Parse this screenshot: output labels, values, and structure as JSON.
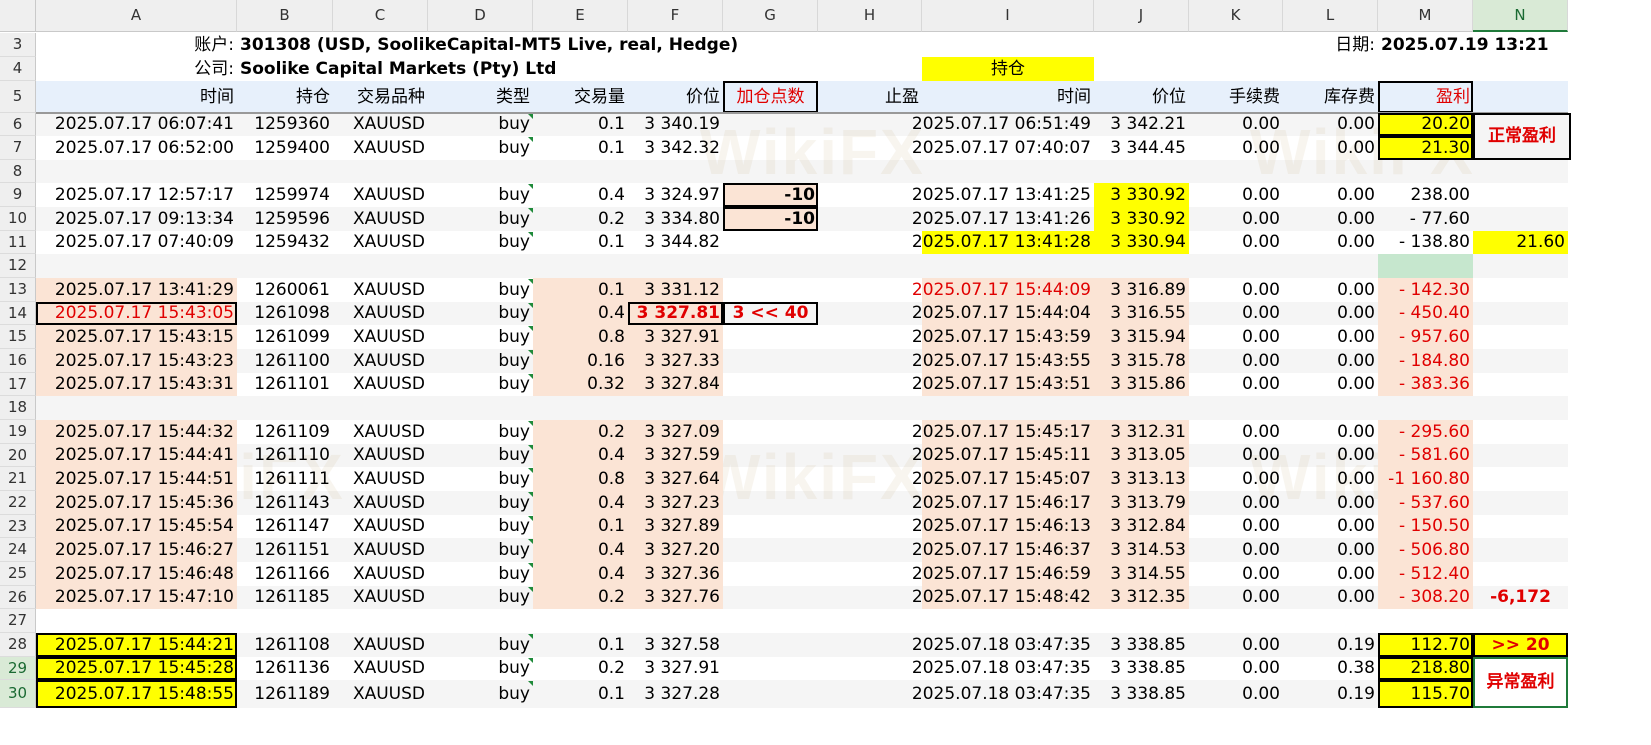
{
  "columns": [
    "A",
    "B",
    "C",
    "D",
    "E",
    "F",
    "G",
    "H",
    "I",
    "J",
    "K",
    "L",
    "M",
    "N"
  ],
  "info": {
    "account_label": "账户:",
    "account_value": "301308 (USD, SoolikeCapital-MT5 Live, real, Hedge)",
    "company_label": "公司:",
    "company_value": "Soolike Capital Markets (Pty) Ltd",
    "date_label": "日期:",
    "date_value": "2025.07.19 13:21",
    "section_title": "持仓"
  },
  "headers": {
    "time": "时间",
    "position": "持仓",
    "symbol": "交易品种",
    "type": "类型",
    "volume": "交易量",
    "price": "价位",
    "add_points": "加仓点数",
    "take_profit": "止盈",
    "close_time": "时间",
    "close_price": "价位",
    "commission": "手续费",
    "swap": "库存费",
    "profit": "盈利"
  },
  "rows": [
    {
      "n": "6",
      "time": "2025.07.17 06:07:41",
      "pos": "1259360",
      "sym": "XAUUSD",
      "type": "buy",
      "vol": "0.1",
      "price": "3 340.19",
      "g": "",
      "ctime": "2025.07.17 06:51:49",
      "cprice": "3 342.21",
      "fee": "0.00",
      "swap": "0.00",
      "profit": "20.20",
      "n_col": ""
    },
    {
      "n": "7",
      "time": "2025.07.17 06:52:00",
      "pos": "1259400",
      "sym": "XAUUSD",
      "type": "buy",
      "vol": "0.1",
      "price": "3 342.32",
      "g": "",
      "ctime": "2025.07.17 07:40:07",
      "cprice": "3 344.45",
      "fee": "0.00",
      "swap": "0.00",
      "profit": "21.30",
      "n_col": ""
    },
    {
      "n": "8"
    },
    {
      "n": "9",
      "time": "2025.07.17 12:57:17",
      "pos": "1259974",
      "sym": "XAUUSD",
      "type": "buy",
      "vol": "0.4",
      "price": "3 324.97",
      "g": "-10",
      "ctime": "2025.07.17 13:41:25",
      "cprice": "3 330.92",
      "fee": "0.00",
      "swap": "0.00",
      "profit": "238.00",
      "n_col": ""
    },
    {
      "n": "10",
      "time": "2025.07.17 09:13:34",
      "pos": "1259596",
      "sym": "XAUUSD",
      "type": "buy",
      "vol": "0.2",
      "price": "3 334.80",
      "g": "-10",
      "ctime": "2025.07.17 13:41:26",
      "cprice": "3 330.92",
      "fee": "0.00",
      "swap": "0.00",
      "profit": "- 77.60",
      "n_col": ""
    },
    {
      "n": "11",
      "time": "2025.07.17 07:40:09",
      "pos": "1259432",
      "sym": "XAUUSD",
      "type": "buy",
      "vol": "0.1",
      "price": "3 344.82",
      "g": "",
      "ctime": "2025.07.17 13:41:28",
      "cprice": "3 330.94",
      "fee": "0.00",
      "swap": "0.00",
      "profit": "- 138.80",
      "n_col": "21.60"
    },
    {
      "n": "12"
    },
    {
      "n": "13",
      "time": "2025.07.17 13:41:29",
      "pos": "1260061",
      "sym": "XAUUSD",
      "type": "buy",
      "vol": "0.1",
      "price": "3 331.12",
      "g": "",
      "ctime": "2025.07.17 15:44:09",
      "cprice": "3 316.89",
      "fee": "0.00",
      "swap": "0.00",
      "profit": "- 142.30",
      "n_col": ""
    },
    {
      "n": "14",
      "time": "2025.07.17 15:43:05",
      "pos": "1261098",
      "sym": "XAUUSD",
      "type": "buy",
      "vol": "0.4",
      "price": "3 327.81",
      "g": "3 << 40",
      "ctime": "2025.07.17 15:44:04",
      "cprice": "3 316.55",
      "fee": "0.00",
      "swap": "0.00",
      "profit": "- 450.40",
      "n_col": ""
    },
    {
      "n": "15",
      "time": "2025.07.17 15:43:15",
      "pos": "1261099",
      "sym": "XAUUSD",
      "type": "buy",
      "vol": "0.8",
      "price": "3 327.91",
      "g": "",
      "ctime": "2025.07.17 15:43:59",
      "cprice": "3 315.94",
      "fee": "0.00",
      "swap": "0.00",
      "profit": "- 957.60",
      "n_col": ""
    },
    {
      "n": "16",
      "time": "2025.07.17 15:43:23",
      "pos": "1261100",
      "sym": "XAUUSD",
      "type": "buy",
      "vol": "0.16",
      "price": "3 327.33",
      "g": "",
      "ctime": "2025.07.17 15:43:55",
      "cprice": "3 315.78",
      "fee": "0.00",
      "swap": "0.00",
      "profit": "- 184.80",
      "n_col": ""
    },
    {
      "n": "17",
      "time": "2025.07.17 15:43:31",
      "pos": "1261101",
      "sym": "XAUUSD",
      "type": "buy",
      "vol": "0.32",
      "price": "3 327.84",
      "g": "",
      "ctime": "2025.07.17 15:43:51",
      "cprice": "3 315.86",
      "fee": "0.00",
      "swap": "0.00",
      "profit": "- 383.36",
      "n_col": ""
    },
    {
      "n": "18"
    },
    {
      "n": "19",
      "time": "2025.07.17 15:44:32",
      "pos": "1261109",
      "sym": "XAUUSD",
      "type": "buy",
      "vol": "0.2",
      "price": "3 327.09",
      "g": "",
      "ctime": "2025.07.17 15:45:17",
      "cprice": "3 312.31",
      "fee": "0.00",
      "swap": "0.00",
      "profit": "- 295.60",
      "n_col": ""
    },
    {
      "n": "20",
      "time": "2025.07.17 15:44:41",
      "pos": "1261110",
      "sym": "XAUUSD",
      "type": "buy",
      "vol": "0.4",
      "price": "3 327.59",
      "g": "",
      "ctime": "2025.07.17 15:45:11",
      "cprice": "3 313.05",
      "fee": "0.00",
      "swap": "0.00",
      "profit": "- 581.60",
      "n_col": ""
    },
    {
      "n": "21",
      "time": "2025.07.17 15:44:51",
      "pos": "1261111",
      "sym": "XAUUSD",
      "type": "buy",
      "vol": "0.8",
      "price": "3 327.64",
      "g": "",
      "ctime": "2025.07.17 15:45:07",
      "cprice": "3 313.13",
      "fee": "0.00",
      "swap": "0.00",
      "profit": "-1 160.80",
      "n_col": ""
    },
    {
      "n": "22",
      "time": "2025.07.17 15:45:36",
      "pos": "1261143",
      "sym": "XAUUSD",
      "type": "buy",
      "vol": "0.4",
      "price": "3 327.23",
      "g": "",
      "ctime": "2025.07.17 15:46:17",
      "cprice": "3 313.79",
      "fee": "0.00",
      "swap": "0.00",
      "profit": "- 537.60",
      "n_col": ""
    },
    {
      "n": "23",
      "time": "2025.07.17 15:45:54",
      "pos": "1261147",
      "sym": "XAUUSD",
      "type": "buy",
      "vol": "0.1",
      "price": "3 327.89",
      "g": "",
      "ctime": "2025.07.17 15:46:13",
      "cprice": "3 312.84",
      "fee": "0.00",
      "swap": "0.00",
      "profit": "- 150.50",
      "n_col": ""
    },
    {
      "n": "24",
      "time": "2025.07.17 15:46:27",
      "pos": "1261151",
      "sym": "XAUUSD",
      "type": "buy",
      "vol": "0.4",
      "price": "3 327.20",
      "g": "",
      "ctime": "2025.07.17 15:46:37",
      "cprice": "3 314.53",
      "fee": "0.00",
      "swap": "0.00",
      "profit": "- 506.80",
      "n_col": ""
    },
    {
      "n": "25",
      "time": "2025.07.17 15:46:48",
      "pos": "1261166",
      "sym": "XAUUSD",
      "type": "buy",
      "vol": "0.4",
      "price": "3 327.36",
      "g": "",
      "ctime": "2025.07.17 15:46:59",
      "cprice": "3 314.55",
      "fee": "0.00",
      "swap": "0.00",
      "profit": "- 512.40",
      "n_col": ""
    },
    {
      "n": "26",
      "time": "2025.07.17 15:47:10",
      "pos": "1261185",
      "sym": "XAUUSD",
      "type": "buy",
      "vol": "0.2",
      "price": "3 327.76",
      "g": "",
      "ctime": "2025.07.17 15:48:42",
      "cprice": "3 312.35",
      "fee": "0.00",
      "swap": "0.00",
      "profit": "- 308.20",
      "n_col": "-6,172"
    },
    {
      "n": "27"
    },
    {
      "n": "28",
      "time": "2025.07.17 15:44:21",
      "pos": "1261108",
      "sym": "XAUUSD",
      "type": "buy",
      "vol": "0.1",
      "price": "3 327.58",
      "g": "",
      "ctime": "2025.07.18 03:47:35",
      "cprice": "3 338.85",
      "fee": "0.00",
      "swap": "0.19",
      "profit": "112.70",
      "n_col": ">> 20"
    },
    {
      "n": "29",
      "time": "2025.07.17 15:45:28",
      "pos": "1261136",
      "sym": "XAUUSD",
      "type": "buy",
      "vol": "0.2",
      "price": "3 327.91",
      "g": "",
      "ctime": "2025.07.18 03:47:35",
      "cprice": "3 338.85",
      "fee": "0.00",
      "swap": "0.38",
      "profit": "218.80",
      "n_col": ""
    },
    {
      "n": "30",
      "time": "2025.07.17 15:48:55",
      "pos": "1261189",
      "sym": "XAUUSD",
      "type": "buy",
      "vol": "0.1",
      "price": "3 327.28",
      "g": "",
      "ctime": "2025.07.18 03:47:35",
      "cprice": "3 338.85",
      "fee": "0.00",
      "swap": "0.19",
      "profit": "115.70",
      "n_col": ""
    }
  ],
  "side_labels": {
    "normal_profit": "正常盈利",
    "abnormal_profit": "异常盈利"
  },
  "watermark": "WikiFX",
  "colors": {
    "highlight_yellow": "#ffff00",
    "peach": "#fbe4d5",
    "loss_red": "#e00000",
    "header_blue": "#e7f0fb",
    "green_fill": "#c6e7ce"
  }
}
